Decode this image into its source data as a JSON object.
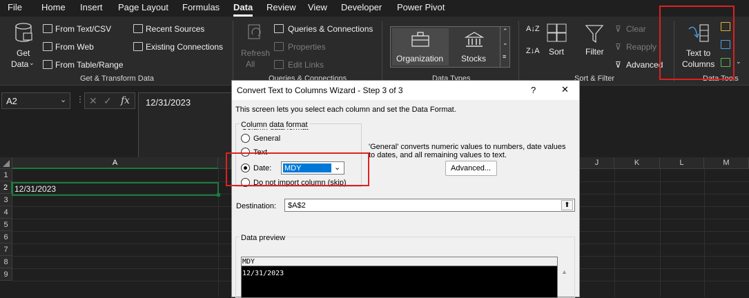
{
  "menu": {
    "items": [
      "File",
      "Home",
      "Insert",
      "Page Layout",
      "Formulas",
      "Data",
      "Review",
      "View",
      "Developer",
      "Power Pivot"
    ],
    "active": "Data"
  },
  "ribbon": {
    "get_data": {
      "line1": "Get",
      "line2": "Data"
    },
    "from_text_csv": "From Text/CSV",
    "from_web": "From Web",
    "from_table_range": "From Table/Range",
    "recent_sources": "Recent Sources",
    "existing_connections": "Existing Connections",
    "group_get_transform": "Get & Transform Data",
    "refresh_all": {
      "line1": "Refresh",
      "line2": "All"
    },
    "queries_connections": "Queries & Connections",
    "properties": "Properties",
    "edit_links": "Edit Links",
    "group_queries": "Queries & Connections",
    "organization": "Organization",
    "stocks": "Stocks",
    "group_data_types": "Data Types",
    "sort": "Sort",
    "filter": "Filter",
    "clear": "Clear",
    "reapply": "Reapply",
    "advanced": "Advanced",
    "group_sort_filter": "Sort & Filter",
    "text_to_columns": {
      "line1": "Text to",
      "line2": "Columns"
    },
    "group_data_tools": "Data Tools"
  },
  "formula_bar": {
    "name_box": "A2",
    "fx": "fx",
    "value": "12/31/2023"
  },
  "grid": {
    "columns": [
      "A",
      "J",
      "K",
      "L",
      "M"
    ],
    "rows": [
      "1",
      "2",
      "3",
      "4",
      "5",
      "6",
      "7",
      "8",
      "9"
    ],
    "a2_value": "12/31/2023"
  },
  "dialog": {
    "title": "Convert Text to Columns Wizard - Step 3 of 3",
    "help": "?",
    "close": "✕",
    "intro": "This screen lets you select each column and set the Data Format.",
    "group_title": "Column data format",
    "opt_general": "General",
    "opt_text": "Text",
    "opt_date": "Date:",
    "date_format": "MDY",
    "opt_skip": "Do not import column (skip)",
    "desc_line1": "'General' converts numeric values to numbers, date values",
    "desc_line2": "to dates, and all remaining values to text.",
    "advanced_btn": "Advanced...",
    "destination_label": "Destination:",
    "destination_value": "$A$2",
    "preview_label": "Data preview",
    "preview_header": "MDY",
    "preview_value": "12/31/2023"
  },
  "colors": {
    "highlight": "#e02020",
    "selection": "#1e7a3d",
    "date_select_bg": "#0078d7"
  }
}
